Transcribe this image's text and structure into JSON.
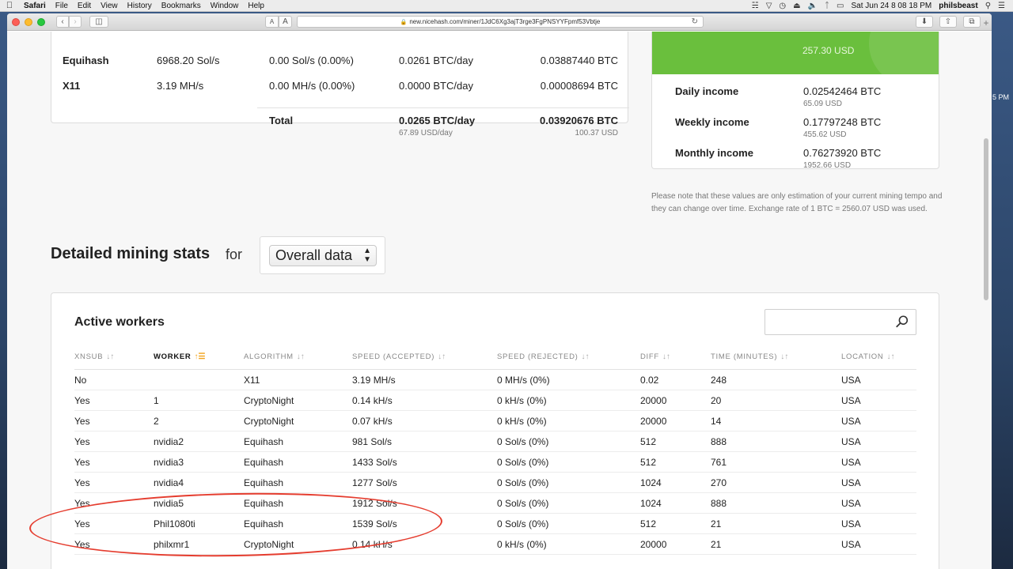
{
  "menubar": {
    "app": "Safari",
    "items": [
      "File",
      "Edit",
      "View",
      "History",
      "Bookmarks",
      "Window",
      "Help"
    ],
    "datetime": "Sat Jun 24  8 08 18 PM",
    "user": "philsbeast"
  },
  "browser": {
    "url": "new.nicehash.com/miner/1JdC6Xg3ajT3rge3FgPNSYYFpmf53Vbtje",
    "font_small": "A",
    "font_large": "A"
  },
  "desktop": {
    "clock_fragment": "5 PM"
  },
  "algo_table": {
    "rows": [
      {
        "name": "Equihash",
        "speed": "6968.20 Sol/s",
        "rejected": "0.00 Sol/s (0.00%)",
        "btc_day": "0.0261 BTC/day",
        "btc": "0.03887440 BTC"
      },
      {
        "name": "X11",
        "speed": "3.19 MH/s",
        "rejected": "0.00 MH/s (0.00%)",
        "btc_day": "0.0000 BTC/day",
        "btc": "0.00008694 BTC"
      }
    ],
    "total": {
      "label": "Total",
      "btc_day": "0.0265 BTC/day",
      "usd_day": "67.89 USD/day",
      "btc": "0.03920676 BTC",
      "usd": "100.37 USD"
    }
  },
  "income": {
    "balance_usd": "257.30 USD",
    "rows": [
      {
        "label": "Daily income",
        "btc": "0.02542464 BTC",
        "usd": "65.09 USD"
      },
      {
        "label": "Weekly income",
        "btc": "0.17797248 BTC",
        "usd": "455.62 USD"
      },
      {
        "label": "Monthly income",
        "btc": "0.76273920 BTC",
        "usd": "1952.66 USD"
      }
    ],
    "note": "Please note that these values are only estimation of your current mining tempo and they can change over time. Exchange rate of 1 BTC = 2560.07 USD was used."
  },
  "detailed": {
    "title": "Detailed mining stats",
    "for_label": "for",
    "select_value": "Overall data"
  },
  "workers": {
    "title": "Active workers",
    "search_placeholder": "",
    "columns": [
      "XNSUB",
      "WORKER",
      "ALGORITHM",
      "SPEED (ACCEPTED)",
      "SPEED (REJECTED)",
      "DIFF",
      "TIME (MINUTES)",
      "LOCATION"
    ],
    "rows": [
      [
        "No",
        "",
        "X11",
        "3.19 MH/s",
        "0 MH/s (0%)",
        "0.02",
        "248",
        "USA"
      ],
      [
        "Yes",
        "1",
        "CryptoNight",
        "0.14 kH/s",
        "0 kH/s (0%)",
        "20000",
        "20",
        "USA"
      ],
      [
        "Yes",
        "2",
        "CryptoNight",
        "0.07 kH/s",
        "0 kH/s (0%)",
        "20000",
        "14",
        "USA"
      ],
      [
        "Yes",
        "nvidia2",
        "Equihash",
        "981 Sol/s",
        "0 Sol/s (0%)",
        "512",
        "888",
        "USA"
      ],
      [
        "Yes",
        "nvidia3",
        "Equihash",
        "1433 Sol/s",
        "0 Sol/s (0%)",
        "512",
        "761",
        "USA"
      ],
      [
        "Yes",
        "nvidia4",
        "Equihash",
        "1277 Sol/s",
        "0 Sol/s (0%)",
        "1024",
        "270",
        "USA"
      ],
      [
        "Yes",
        "nvidia5",
        "Equihash",
        "1912 Sol/s",
        "0 Sol/s (0%)",
        "1024",
        "888",
        "USA"
      ],
      [
        "Yes",
        "Phil1080ti",
        "Equihash",
        "1539 Sol/s",
        "0 Sol/s (0%)",
        "512",
        "21",
        "USA"
      ],
      [
        "Yes",
        "philxmr1",
        "CryptoNight",
        "0.14 kH/s",
        "0 kH/s (0%)",
        "20000",
        "21",
        "USA"
      ]
    ],
    "sorted_column": "WORKER"
  },
  "colors": {
    "accent_green": "#6abf3d",
    "sort_orange": "#f2a31b",
    "annotation_red": "#e53d2f"
  }
}
